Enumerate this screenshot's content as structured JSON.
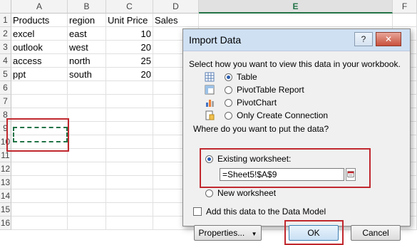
{
  "sheet": {
    "columns": [
      "A",
      "B",
      "C",
      "D",
      "E",
      "F"
    ],
    "selected_column": "E",
    "rows": [
      {
        "n": "1",
        "a": "Products",
        "b": "region",
        "c": "Unit Price",
        "d": "Sales"
      },
      {
        "n": "2",
        "a": "excel",
        "b": "east",
        "c": "10",
        "d": ""
      },
      {
        "n": "3",
        "a": "outlook",
        "b": "west",
        "c": "20",
        "d": ""
      },
      {
        "n": "4",
        "a": "access",
        "b": "north",
        "c": "25",
        "d": ""
      },
      {
        "n": "5",
        "a": "ppt",
        "b": "south",
        "c": "20",
        "d": ""
      },
      {
        "n": "6",
        "a": "",
        "b": "",
        "c": "",
        "d": ""
      },
      {
        "n": "7",
        "a": "",
        "b": "",
        "c": "",
        "d": ""
      },
      {
        "n": "8",
        "a": "",
        "b": "",
        "c": "",
        "d": ""
      },
      {
        "n": "9",
        "a": "",
        "b": "",
        "c": "",
        "d": ""
      },
      {
        "n": "10",
        "a": "",
        "b": "",
        "c": "",
        "d": ""
      },
      {
        "n": "11",
        "a": "",
        "b": "",
        "c": "",
        "d": ""
      },
      {
        "n": "12",
        "a": "",
        "b": "",
        "c": "",
        "d": ""
      },
      {
        "n": "13",
        "a": "",
        "b": "",
        "c": "",
        "d": ""
      },
      {
        "n": "14",
        "a": "",
        "b": "",
        "c": "",
        "d": ""
      },
      {
        "n": "15",
        "a": "",
        "b": "",
        "c": "",
        "d": ""
      },
      {
        "n": "16",
        "a": "",
        "b": "",
        "c": "",
        "d": ""
      }
    ]
  },
  "dialog": {
    "title": "Import Data",
    "help": "?",
    "close": "✕",
    "view_prompt": "Select how you want to view this data in your workbook.",
    "view_options": [
      {
        "label": "Table",
        "selected": true,
        "icon": "table-icon"
      },
      {
        "label": "PivotTable Report",
        "selected": false,
        "icon": "pivottable-icon"
      },
      {
        "label": "PivotChart",
        "selected": false,
        "icon": "pivotchart-icon"
      },
      {
        "label": "Only Create Connection",
        "selected": false,
        "icon": "connection-icon"
      }
    ],
    "put_prompt": "Where do you want to put the data?",
    "existing_label": "Existing worksheet:",
    "existing_value": "=Sheet5!$A$9",
    "new_label": "New worksheet",
    "data_model_label": "Add this data to the Data Model",
    "properties_label": "Properties...",
    "ok_label": "OK",
    "cancel_label": "Cancel"
  },
  "colors": {
    "excel_green": "#217346",
    "highlight_red": "#c0282e",
    "titlebar": "#cfe0f3"
  }
}
